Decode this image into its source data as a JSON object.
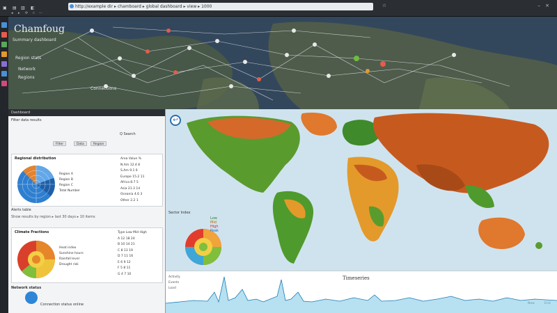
{
  "window": {
    "tabs": [
      "▣",
      "▤",
      "▥",
      "◧"
    ],
    "address": "http://example dir ▸ chamboard ▸ global dashboard ▸ view ▸ 1000",
    "toolbar_items": [
      "◂",
      "▸",
      "⟳",
      "☆",
      "⋯"
    ]
  },
  "top_map": {
    "title": "Chamfoug",
    "labels": [
      "Summary dashboard",
      "Region stats",
      "Network",
      "Regions",
      "Connections"
    ]
  },
  "left_panel": {
    "header": "Dashboard",
    "sub1": "Filter data results",
    "chips": [
      "Filter",
      "Data",
      "Region"
    ],
    "search_label": "Q Search",
    "card1": {
      "title": "Regional distribution",
      "legend": [
        "Region A",
        "Region B",
        "Region C",
        "Total Number"
      ],
      "table": [
        [
          "Area",
          "Value",
          "%"
        ],
        [
          "N.Am",
          "12.4",
          "8"
        ],
        [
          "S.Am",
          "9.1",
          "6"
        ],
        [
          "Europe",
          "15.2",
          "11"
        ],
        [
          "Africa",
          "8.7",
          "5"
        ],
        [
          "Asia",
          "21.3",
          "14"
        ],
        [
          "Oceania",
          "4.6",
          "3"
        ],
        [
          "Other",
          "2.2",
          "1"
        ]
      ]
    },
    "section_label": "Alerts table",
    "filter_line": "Show results by region ▸ last 30 days ▸ 10 items",
    "card2": {
      "title": "Climate Fractions",
      "legend": [
        "Heat index",
        "Sunshine hours",
        "Rainfall level",
        "Drought risk"
      ],
      "table": [
        [
          "Type",
          "Low",
          "Mid",
          "High"
        ],
        [
          "A",
          "12",
          "18",
          "24"
        ],
        [
          "B",
          "10",
          "14",
          "21"
        ],
        [
          "C",
          "8",
          "13",
          "19"
        ],
        [
          "D",
          "7",
          "11",
          "16"
        ],
        [
          "E",
          "6",
          "9",
          "12"
        ],
        [
          "F",
          "5",
          "8",
          "11"
        ],
        [
          "G",
          "4",
          "7",
          "10"
        ]
      ]
    },
    "footer_title": "Network status",
    "footer_text": "Connection status online"
  },
  "world": {
    "back_icon": "↩",
    "inset_label": "Sector Index",
    "inset_legend": [
      "Low",
      "Mid",
      "High",
      "Peak"
    ]
  },
  "timeline": {
    "title": "Timeseries",
    "left_labels": [
      "Activity",
      "Events",
      "Load"
    ],
    "right_labels": [
      "Now",
      "End"
    ]
  },
  "colors": {
    "accent": "#2a6fb1",
    "map_hot": "#c65a1e",
    "map_warm": "#e39a2a",
    "map_green": "#4f9a2c",
    "ocean": "#cfe3ee"
  }
}
